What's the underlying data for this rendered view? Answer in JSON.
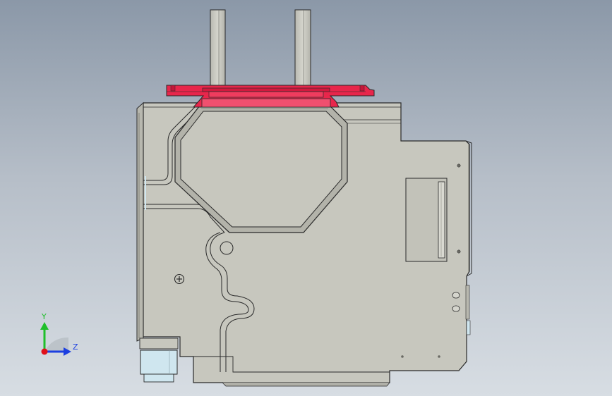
{
  "viewport": {
    "background_top": "#8b98a8",
    "background_bottom": "#d7dde3"
  },
  "triad": {
    "y_label": "Y",
    "z_label": "Z",
    "y_color": "#1fbf2a",
    "z_color": "#1c3fe0",
    "x_color": "#e0101a"
  },
  "model": {
    "part_color": "#c7c7be",
    "edge_color": "#2a2a2a",
    "highlight_color": "#e8264b",
    "accent_blue": "#cfe6ef"
  }
}
